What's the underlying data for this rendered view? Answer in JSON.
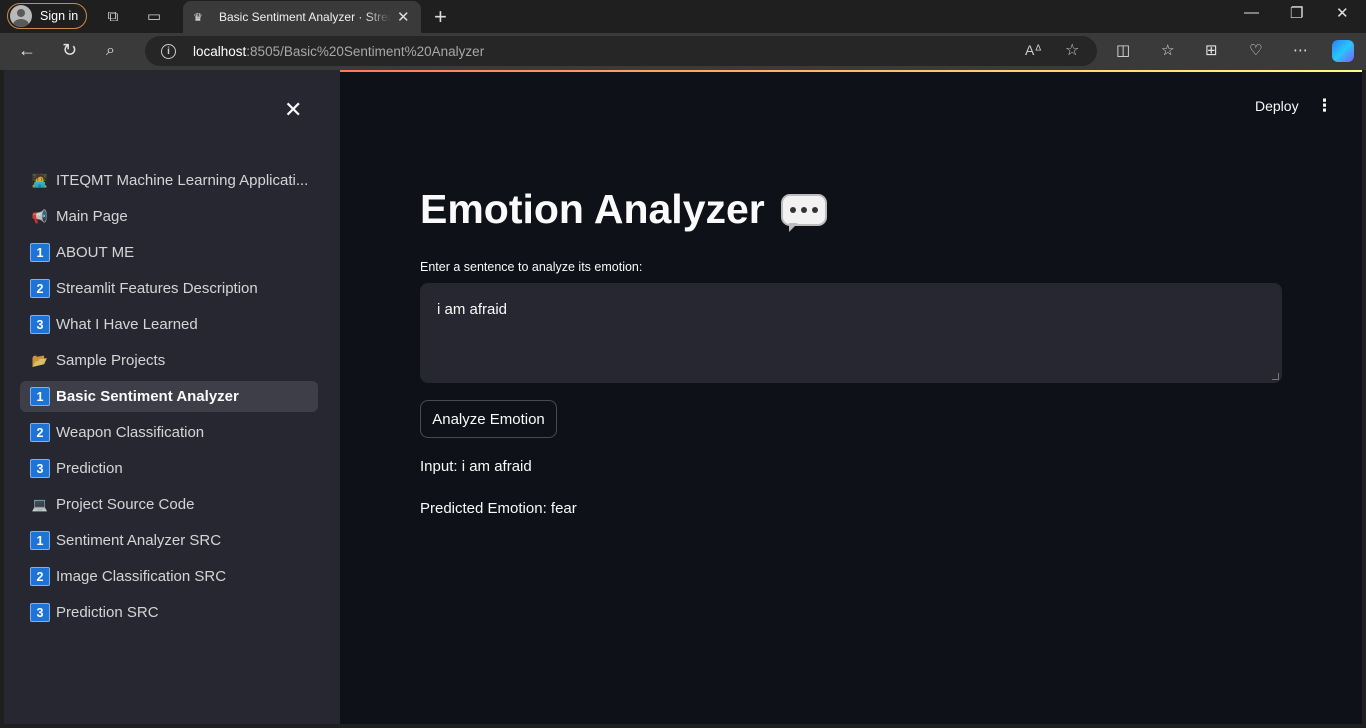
{
  "browser": {
    "signin_label": "Sign in",
    "tab_title": "Basic Sentiment Analyzer · Streamlit",
    "url_host": "localhost",
    "url_path": ":8505/Basic%20Sentiment%20Analyzer"
  },
  "header": {
    "deploy_label": "Deploy",
    "menu_glyph": "⋮"
  },
  "sidebar": {
    "items": [
      {
        "icon": "🧑‍💻",
        "num": null,
        "label": "ITEQMT Machine Learning Applicati...",
        "active": false
      },
      {
        "icon": "📢",
        "num": null,
        "label": "Main Page",
        "active": false
      },
      {
        "icon": null,
        "num": "1",
        "label": "ABOUT ME",
        "active": false
      },
      {
        "icon": null,
        "num": "2",
        "label": "Streamlit Features Description",
        "active": false
      },
      {
        "icon": null,
        "num": "3",
        "label": "What I Have Learned",
        "active": false
      },
      {
        "icon": "📂",
        "num": null,
        "label": "Sample Projects",
        "active": false
      },
      {
        "icon": null,
        "num": "1",
        "label": "Basic Sentiment Analyzer",
        "active": true
      },
      {
        "icon": null,
        "num": "2",
        "label": "Weapon Classification",
        "active": false
      },
      {
        "icon": null,
        "num": "3",
        "label": "Prediction",
        "active": false
      },
      {
        "icon": "💻",
        "num": null,
        "label": "Project Source Code",
        "active": false
      },
      {
        "icon": null,
        "num": "1",
        "label": "Sentiment Analyzer SRC",
        "active": false
      },
      {
        "icon": null,
        "num": "2",
        "label": "Image Classification SRC",
        "active": false
      },
      {
        "icon": null,
        "num": "3",
        "label": "Prediction SRC",
        "active": false
      }
    ]
  },
  "main": {
    "title": "Emotion Analyzer",
    "input_label": "Enter a sentence to analyze its emotion:",
    "input_value": "i am afraid",
    "button_label": "Analyze Emotion",
    "result_input": "Input: i am afraid",
    "result_emotion": "Predicted Emotion: fear"
  },
  "colors": {
    "page_bg": "#0e1117",
    "sidebar_bg": "#262730",
    "accent": "#ff4b4b",
    "num_badge": "#1e74d6"
  }
}
